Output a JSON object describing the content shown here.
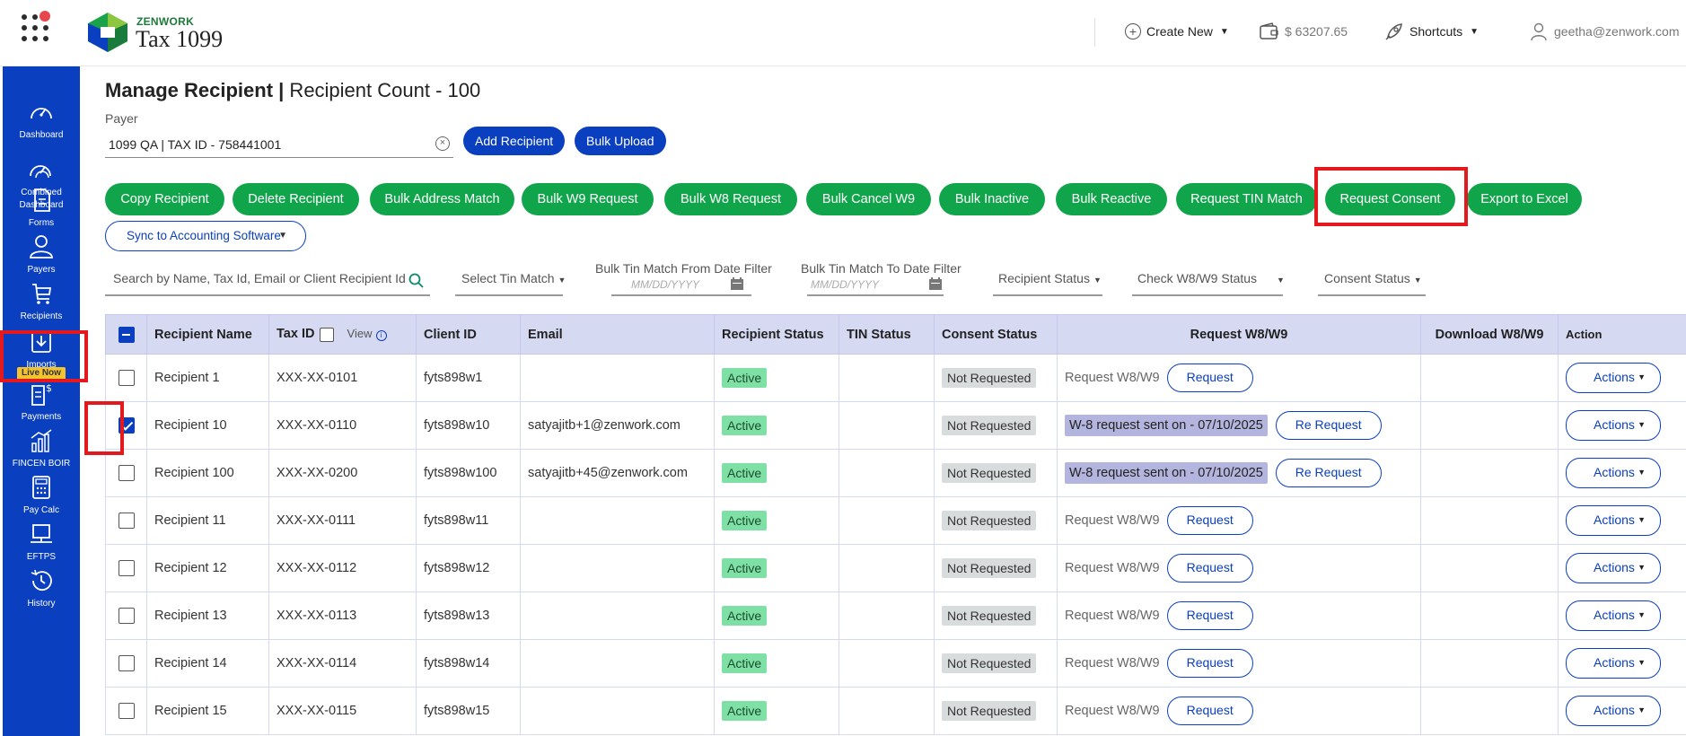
{
  "app": {
    "brand_small": "ZENWORK",
    "brand_big": "Tax 1099"
  },
  "topbar": {
    "create_new": "Create New",
    "wallet": "$ 63207.65",
    "shortcuts": "Shortcuts",
    "user": "geetha@zenwork.com"
  },
  "sidebar": {
    "items": [
      {
        "label": "Dashboard",
        "icon": "gauge-icon"
      },
      {
        "label": "Combined Dashboard",
        "icon": "combined-gauge-icon"
      },
      {
        "label": "Forms",
        "icon": "document-icon"
      },
      {
        "label": "Payers",
        "icon": "user-icon"
      },
      {
        "label": "Recipients",
        "icon": "cart-icon"
      },
      {
        "label": "Imports",
        "icon": "download-icon"
      },
      {
        "label": "Payments",
        "icon": "payments-icon"
      },
      {
        "label": "FINCEN BOIR",
        "icon": "bar-chart-icon"
      },
      {
        "label": "Pay Calc",
        "icon": "calculator-icon"
      },
      {
        "label": "EFTPS",
        "icon": "monitor-icon"
      },
      {
        "label": "History",
        "icon": "history-icon"
      }
    ],
    "live_badge": "Live Now"
  },
  "page": {
    "title_bold": "Manage Recipient |",
    "title_rest": " Recipient Count - 100",
    "payer_label": "Payer",
    "payer_value": "1099 QA | TAX ID - 758441001",
    "add_recipient": "Add Recipient",
    "bulk_upload": "Bulk Upload"
  },
  "actions": [
    "Copy Recipient",
    "Delete Recipient",
    "Bulk Address Match",
    "Bulk W9 Request",
    "Bulk W8 Request",
    "Bulk Cancel W9",
    "Bulk Inactive",
    "Bulk Reactive",
    "Request TIN Match",
    "Request Consent",
    "Export to Excel"
  ],
  "sync_button": "Sync to Accounting Software",
  "filters": {
    "search_placeholder": "Search by Name, Tax Id, Email or Client Recipient Id",
    "tin_match": "Select Tin Match",
    "from_label": "Bulk Tin Match From Date Filter",
    "to_label": "Bulk Tin Match To Date Filter",
    "date_placeholder": "MM/DD/YYYY",
    "recipient_status": "Recipient Status",
    "w8w9_status": "Check W8/W9 Status",
    "consent_status": "Consent Status"
  },
  "table": {
    "headers": {
      "name": "Recipient Name",
      "taxid": "Tax ID",
      "view": "View",
      "client": "Client ID",
      "email": "Email",
      "rstatus": "Recipient Status",
      "tin": "TIN Status",
      "consent": "Consent Status",
      "request": "Request W8/W9",
      "download": "Download W8/W9",
      "action": "Action"
    },
    "rows": [
      {
        "name": "Recipient 1",
        "taxid": "XXX-XX-0101",
        "client": "fyts898w1",
        "email": "",
        "status": "Active",
        "consent": "Not Requested",
        "req_text": "Request W8/W9",
        "req_btn": "Request",
        "sent": "",
        "checked": false
      },
      {
        "name": "Recipient 10",
        "taxid": "XXX-XX-0110",
        "client": "fyts898w10",
        "email": "satyajitb+1@zenwork.com",
        "status": "Active",
        "consent": "Not Requested",
        "req_text": "",
        "req_btn": "Re Request",
        "sent": "W-8 request sent on - 07/10/2025",
        "checked": true
      },
      {
        "name": "Recipient 100",
        "taxid": "XXX-XX-0200",
        "client": "fyts898w100",
        "email": "satyajitb+45@zenwork.com",
        "status": "Active",
        "consent": "Not Requested",
        "req_text": "",
        "req_btn": "Re Request",
        "sent": "W-8 request sent on - 07/10/2025",
        "checked": false
      },
      {
        "name": "Recipient 11",
        "taxid": "XXX-XX-0111",
        "client": "fyts898w11",
        "email": "",
        "status": "Active",
        "consent": "Not Requested",
        "req_text": "Request W8/W9",
        "req_btn": "Request",
        "sent": "",
        "checked": false
      },
      {
        "name": "Recipient 12",
        "taxid": "XXX-XX-0112",
        "client": "fyts898w12",
        "email": "",
        "status": "Active",
        "consent": "Not Requested",
        "req_text": "Request W8/W9",
        "req_btn": "Request",
        "sent": "",
        "checked": false
      },
      {
        "name": "Recipient 13",
        "taxid": "XXX-XX-0113",
        "client": "fyts898w13",
        "email": "",
        "status": "Active",
        "consent": "Not Requested",
        "req_text": "Request W8/W9",
        "req_btn": "Request",
        "sent": "",
        "checked": false
      },
      {
        "name": "Recipient 14",
        "taxid": "XXX-XX-0114",
        "client": "fyts898w14",
        "email": "",
        "status": "Active",
        "consent": "Not Requested",
        "req_text": "Request W8/W9",
        "req_btn": "Request",
        "sent": "",
        "checked": false
      },
      {
        "name": "Recipient 15",
        "taxid": "XXX-XX-0115",
        "client": "fyts898w15",
        "email": "",
        "status": "Active",
        "consent": "Not Requested",
        "req_text": "Request W8/W9",
        "req_btn": "Request",
        "sent": "",
        "checked": false
      }
    ],
    "actions_label": "Actions"
  },
  "colors": {
    "sidebar": "#0a3fbf",
    "green": "#11a54b",
    "highlight": "#e3191d"
  }
}
